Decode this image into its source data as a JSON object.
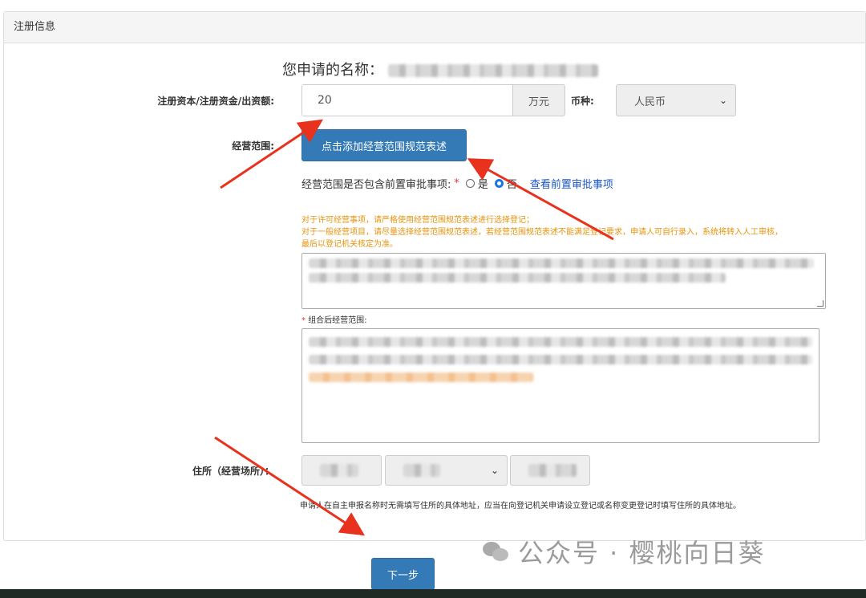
{
  "panel": {
    "title": "注册信息"
  },
  "name": {
    "label": "您申请的名称："
  },
  "capital": {
    "label": "注册资本/注册资金/出资额:",
    "value": "20",
    "unit": "万元",
    "currency_label": "币种:",
    "currency_value": "人民币"
  },
  "scope": {
    "label": "经营范围:",
    "add_button": "点击添加经营范围规范表述",
    "question": "经营范围是否包含前置审批事项:",
    "required_mark": "*",
    "option_yes": "是",
    "option_no": "否",
    "selected": "否",
    "view_link": "查看前置审批事项",
    "notes": [
      "对于许可经营事项，请严格使用经营范围规范表述进行选择登记；",
      "对于一般经营项目，请尽量选择经营范围规范表述，若经营范围规范表述不能满足登记要求，申请人可自行录入，系统将转入人工审核，",
      "最后以登记机关核定为准。"
    ],
    "combined_required": "*",
    "combined_label": "组合后经营范围:"
  },
  "address": {
    "label": "住所（经营场所）：",
    "hint": "申请人在自主申报名称时无需填写住所的具体地址，应当在向登记机关申请设立登记或名称变更登记时填写住所的具体地址。"
  },
  "next_button": "下一步",
  "watermark": "公众号 · 樱桃向日葵",
  "colors": {
    "primary": "#337ab7",
    "note_orange": "#e8930c",
    "arrow_red": "#e8321e",
    "link_blue": "#1a56c4"
  }
}
